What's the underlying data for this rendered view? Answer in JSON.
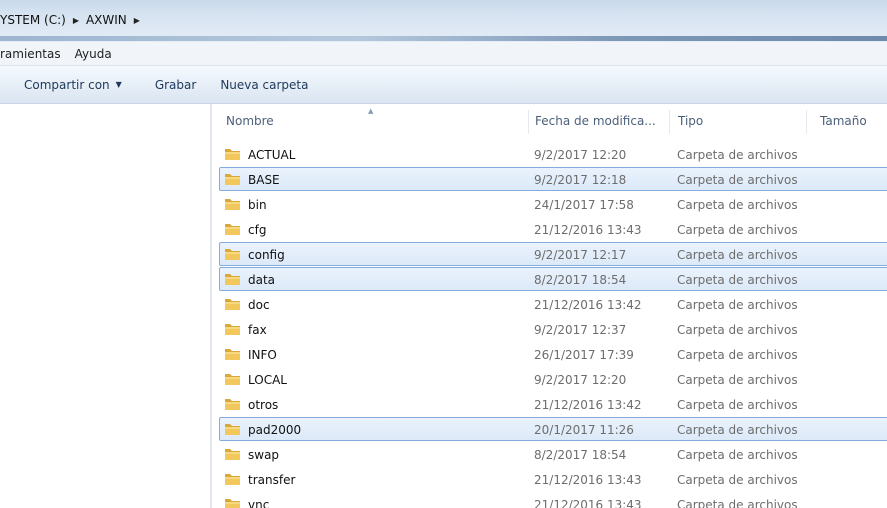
{
  "address": {
    "crumbs": [
      "YSTEM (C:)",
      "AXWIN"
    ]
  },
  "menu": {
    "items": [
      "ramientas",
      "Ayuda"
    ]
  },
  "toolbar": {
    "share_label": "Compartir con",
    "burn_label": "Grabar",
    "new_folder_label": "Nueva carpeta"
  },
  "columns": {
    "name": "Nombre",
    "date": "Fecha de modifica...",
    "type": "Tipo",
    "size": "Tamaño"
  },
  "colors": {
    "selection_fill": "#dce9f8",
    "selection_border": "#84acdd",
    "folder": "#e8b84a"
  },
  "files": [
    {
      "name": "ACTUAL",
      "date": "9/2/2017 12:20",
      "type": "Carpeta de archivos",
      "selected": false
    },
    {
      "name": "BASE",
      "date": "9/2/2017 12:18",
      "type": "Carpeta de archivos",
      "selected": true
    },
    {
      "name": "bin",
      "date": "24/1/2017 17:58",
      "type": "Carpeta de archivos",
      "selected": false
    },
    {
      "name": "cfg",
      "date": "21/12/2016 13:43",
      "type": "Carpeta de archivos",
      "selected": false
    },
    {
      "name": "config",
      "date": "9/2/2017 12:17",
      "type": "Carpeta de archivos",
      "selected": true
    },
    {
      "name": "data",
      "date": "8/2/2017 18:54",
      "type": "Carpeta de archivos",
      "selected": true
    },
    {
      "name": "doc",
      "date": "21/12/2016 13:42",
      "type": "Carpeta de archivos",
      "selected": false
    },
    {
      "name": "fax",
      "date": "9/2/2017 12:37",
      "type": "Carpeta de archivos",
      "selected": false
    },
    {
      "name": "INFO",
      "date": "26/1/2017 17:39",
      "type": "Carpeta de archivos",
      "selected": false
    },
    {
      "name": "LOCAL",
      "date": "9/2/2017 12:20",
      "type": "Carpeta de archivos",
      "selected": false
    },
    {
      "name": "otros",
      "date": "21/12/2016 13:42",
      "type": "Carpeta de archivos",
      "selected": false
    },
    {
      "name": "pad2000",
      "date": "20/1/2017 11:26",
      "type": "Carpeta de archivos",
      "selected": true
    },
    {
      "name": "swap",
      "date": "8/2/2017 18:54",
      "type": "Carpeta de archivos",
      "selected": false
    },
    {
      "name": "transfer",
      "date": "21/12/2016 13:43",
      "type": "Carpeta de archivos",
      "selected": false
    },
    {
      "name": "vnc",
      "date": "21/12/2016 13:43",
      "type": "Carpeta de archivos",
      "selected": false
    }
  ]
}
